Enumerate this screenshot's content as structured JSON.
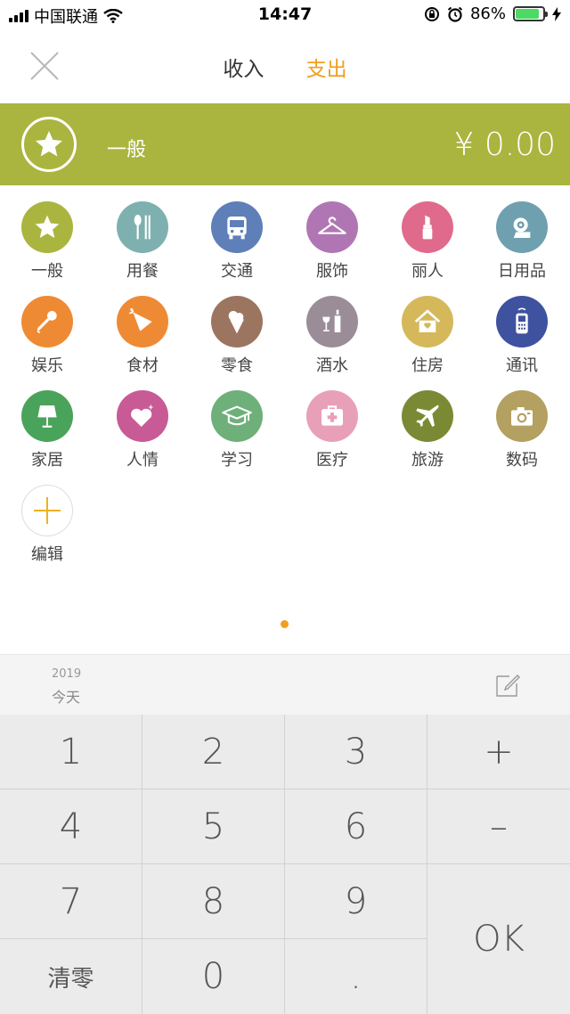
{
  "status_bar": {
    "carrier": "中国联通",
    "time": "14:47",
    "battery": "86%"
  },
  "header": {
    "tab_income": "收入",
    "tab_expense": "支出"
  },
  "banner": {
    "category": "一般",
    "amount": "¥ 0.00",
    "color": "#a9b53e"
  },
  "categories": [
    {
      "label": "一般",
      "icon": "star-icon",
      "color": "#a9b53e"
    },
    {
      "label": "用餐",
      "icon": "utensils-icon",
      "color": "#7fb0b0"
    },
    {
      "label": "交通",
      "icon": "bus-icon",
      "color": "#5f7fb8"
    },
    {
      "label": "服饰",
      "icon": "hanger-icon",
      "color": "#b076b4"
    },
    {
      "label": "丽人",
      "icon": "lipstick-icon",
      "color": "#e06a8c"
    },
    {
      "label": "日用品",
      "icon": "toilet-paper-icon",
      "color": "#6fa0b0"
    },
    {
      "label": "娱乐",
      "icon": "microphone-icon",
      "color": "#ef8a34"
    },
    {
      "label": "食材",
      "icon": "carrot-icon",
      "color": "#ef8a34"
    },
    {
      "label": "零食",
      "icon": "ice-cream-icon",
      "color": "#9c7560"
    },
    {
      "label": "酒水",
      "icon": "wine-icon",
      "color": "#9a8d98"
    },
    {
      "label": "住房",
      "icon": "house-icon",
      "color": "#d4b85a"
    },
    {
      "label": "通讯",
      "icon": "phone-icon",
      "color": "#3f52a0"
    },
    {
      "label": "家居",
      "icon": "lamp-icon",
      "color": "#4aa35a"
    },
    {
      "label": "人情",
      "icon": "heart-icon",
      "color": "#c85a96"
    },
    {
      "label": "学习",
      "icon": "graduation-cap-icon",
      "color": "#6fb07a"
    },
    {
      "label": "医疗",
      "icon": "first-aid-icon",
      "color": "#e8a0b8"
    },
    {
      "label": "旅游",
      "icon": "airplane-icon",
      "color": "#7a8a34"
    },
    {
      "label": "数码",
      "icon": "camera-icon",
      "color": "#b4a060"
    },
    {
      "label": "编辑",
      "icon": "plus-icon",
      "color": "#f0b020"
    }
  ],
  "date": {
    "year": "2019",
    "label": "今天"
  },
  "keypad": {
    "k1": "1",
    "k2": "2",
    "k3": "3",
    "plus": "+",
    "k4": "4",
    "k5": "5",
    "k6": "6",
    "minus": "–",
    "k7": "7",
    "k8": "8",
    "k9": "9",
    "ok": "OK",
    "clear": "清零",
    "k0": "0",
    "dot": "."
  }
}
